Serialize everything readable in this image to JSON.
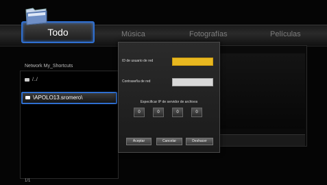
{
  "tabs": {
    "active_label": "Todo",
    "musica": "Música",
    "fotografias": "Fotografías",
    "peliculas": "Películas"
  },
  "browser": {
    "breadcrumb": "Network  My_Shortcuts",
    "up_item": "/../",
    "selected_item": "\\APOLO13.sromero\\",
    "pager": "1/1"
  },
  "dialog": {
    "user_label": "ID de usuario de red",
    "user_value": "",
    "password_label": "Contraseña de red",
    "password_value": "",
    "ip_title": "Especificar IP de servidor de archivos",
    "ip": [
      "0",
      "0",
      "0",
      "0"
    ],
    "buttons": {
      "accept": "Aceptar",
      "cancel": "Cancelar",
      "delete": "Deshacer"
    }
  },
  "colors": {
    "highlight": "#2f6fd0",
    "user_field": "#e8b820"
  }
}
